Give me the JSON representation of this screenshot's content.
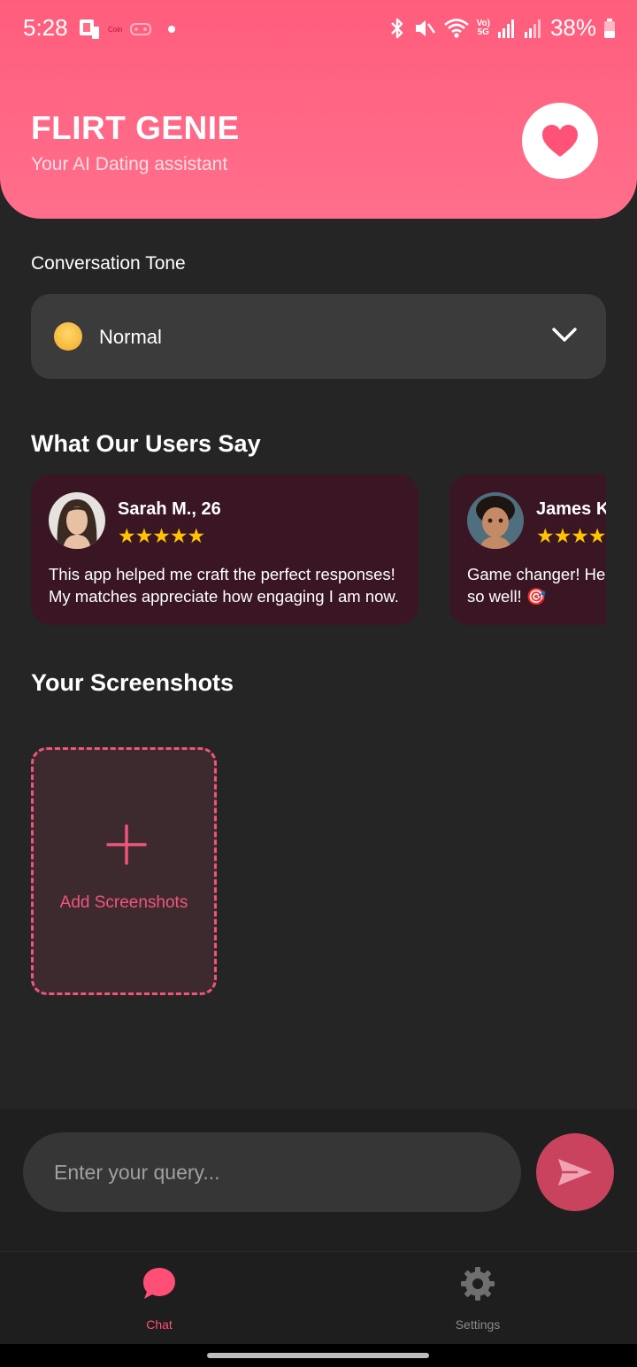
{
  "status_bar": {
    "time": "5:28",
    "battery": "38%",
    "network_label_top": "Vo)",
    "network_label_bottom": "5G",
    "notif_tiny_text": "Coin"
  },
  "header": {
    "title": "FLIRT GENIE",
    "subtitle": "Your AI Dating assistant",
    "gradient_top": "#ff5d7c",
    "gradient_bottom": "#ff6f8c"
  },
  "tone": {
    "label": "Conversation Tone",
    "selected": "Normal",
    "emoji_icon": "smiling-face-icon"
  },
  "reviews": {
    "title": "What Our Users Say",
    "items": [
      {
        "name": "Sarah M., 26",
        "stars": "★★★★★",
        "text": "This app helped me craft the perfect responses! My matches appreciate how engaging I am now."
      },
      {
        "name": "James K",
        "stars": "★★★★",
        "text": "Game changer! He so well! 🎯"
      }
    ]
  },
  "screenshots": {
    "title": "Your Screenshots",
    "add_label": "Add Screenshots"
  },
  "composer": {
    "placeholder": "Enter your query..."
  },
  "tabs": [
    {
      "label": "Chat",
      "icon": "chat-bubble-icon",
      "active": true
    },
    {
      "label": "Settings",
      "icon": "gear-icon",
      "active": false
    }
  ],
  "colors": {
    "accent": "#ff4f76",
    "background": "#252525",
    "card": "#3a1624",
    "star": "#ffc400"
  }
}
